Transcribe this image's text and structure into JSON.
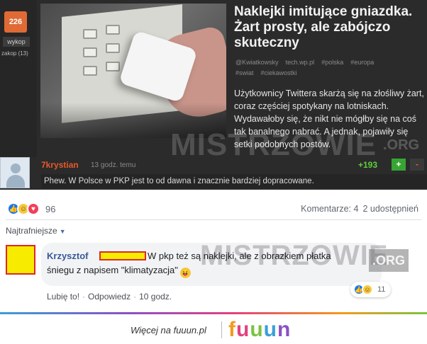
{
  "wykop": {
    "sidebar": {
      "score": "226",
      "vote_button": "wykop",
      "bury_label": "zakop (13)"
    },
    "article": {
      "title": "Naklejki imitujące gniazdka. Żart prosty, ale zabójczo skuteczny",
      "meta": [
        "@Kwiatkowsky",
        "tech.wp.pl",
        "#polska",
        "#europa",
        "#swiat",
        "#ciekawostki"
      ],
      "body": "Użytkownicy Twittera skarżą się na złośliwy żart, coraz częściej spotykany na lotniskach. Wydawałoby się, że nikt nie mógłby się na coś tak banalnego nabrać. A jednak, pojawiły się setki podobnych postów."
    },
    "watermark": {
      "text": "MISTRZOWIE",
      "suffix": ".ORG"
    },
    "comment": {
      "author": "7krystian",
      "time": "13 godz. temu",
      "votes": "+193",
      "plus": "+",
      "minus": "-",
      "text": "Phew. W Polsce w PKP jest to od dawna i znacznie bardziej dopracowane."
    }
  },
  "facebook": {
    "reaction_count": "96",
    "comments_count": "Komentarze: 4",
    "shares_count": "2 udostępnień",
    "sort_label": "Najtrafniejsze",
    "comment": {
      "author": "Krzysztof",
      "text_line1": "W pkp też są naklejki, ale z obrazkiem płatka",
      "text_line2": "śniegu z napisem \"klimatyzacja\"",
      "reaction_count": "11",
      "like_label": "Lubię to!",
      "reply_label": "Odpowiedz",
      "time": "10 godz."
    },
    "watermark": {
      "text": "MISTRZOWIE",
      "suffix": ".ORG"
    }
  },
  "footer": {
    "text": "Więcej na fuuun.pl",
    "logo": [
      "f",
      "u",
      "u",
      "u",
      "n"
    ]
  },
  "colors": {
    "wykop_orange": "#e06a35",
    "vote_green": "#37a534",
    "fb_blue": "#385898",
    "redaction_yellow": "#f7ec00",
    "redaction_red": "#e0262b"
  },
  "icons": {
    "reactions": [
      "like-icon",
      "haha-icon",
      "love-icon"
    ],
    "expand": "chevron-down-icon"
  }
}
